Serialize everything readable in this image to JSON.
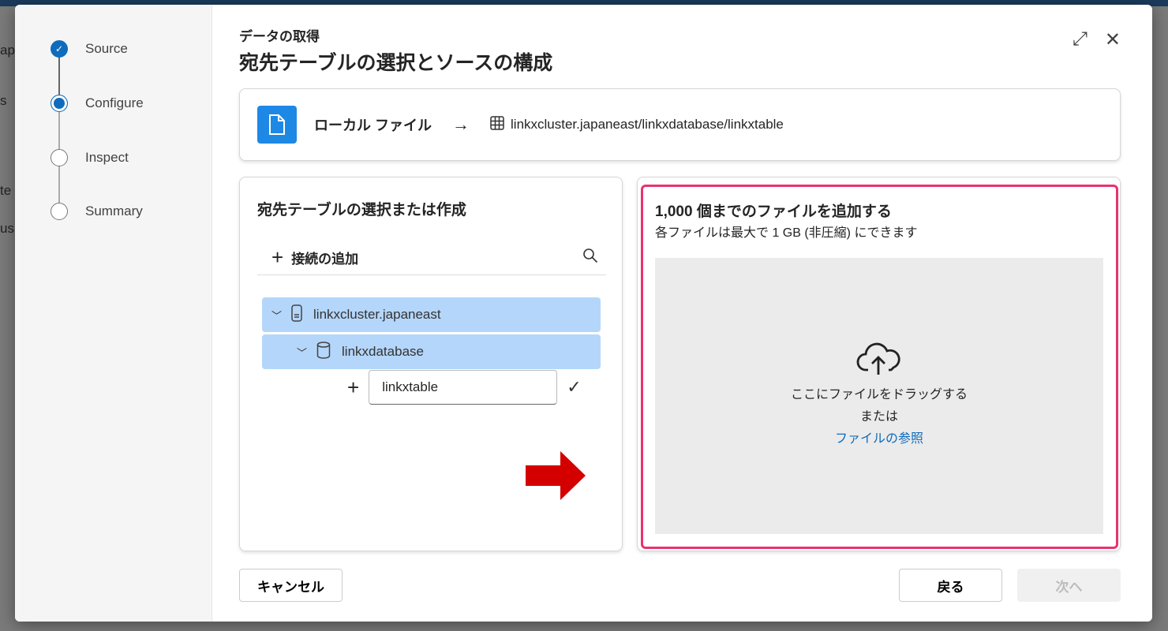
{
  "background": {
    "fragments": [
      "ap",
      "s",
      "te",
      "us"
    ]
  },
  "steps": [
    {
      "label": "Source",
      "state": "done"
    },
    {
      "label": "Configure",
      "state": "current"
    },
    {
      "label": "Inspect",
      "state": "pending"
    },
    {
      "label": "Summary",
      "state": "pending"
    }
  ],
  "header": {
    "subtitle": "データの取得",
    "title": "宛先テーブルの選択とソースの構成"
  },
  "path": {
    "source": "ローカル ファイル",
    "destination": "linkxcluster.japaneast/linkxdatabase/linkxtable"
  },
  "left": {
    "title": "宛先テーブルの選択または作成",
    "add_connection": "接続の追加",
    "tree": {
      "cluster": "linkxcluster.japaneast",
      "database": "linkxdatabase",
      "new_table_value": "linkxtable"
    }
  },
  "right": {
    "title": "1,000 個までのファイルを追加する",
    "subtitle": "各ファイルは最大で 1 GB (非圧縮) にできます",
    "drag_text": "ここにファイルをドラッグする",
    "or_text": "または",
    "browse_link": "ファイルの参照"
  },
  "footer": {
    "cancel": "キャンセル",
    "back": "戻る",
    "next": "次へ",
    "next_disabled": true
  },
  "colors": {
    "accent": "#0f6cbd",
    "selection": "#b4d6fa",
    "highlight": "#e8336e",
    "annotation_arrow": "#d40000"
  }
}
